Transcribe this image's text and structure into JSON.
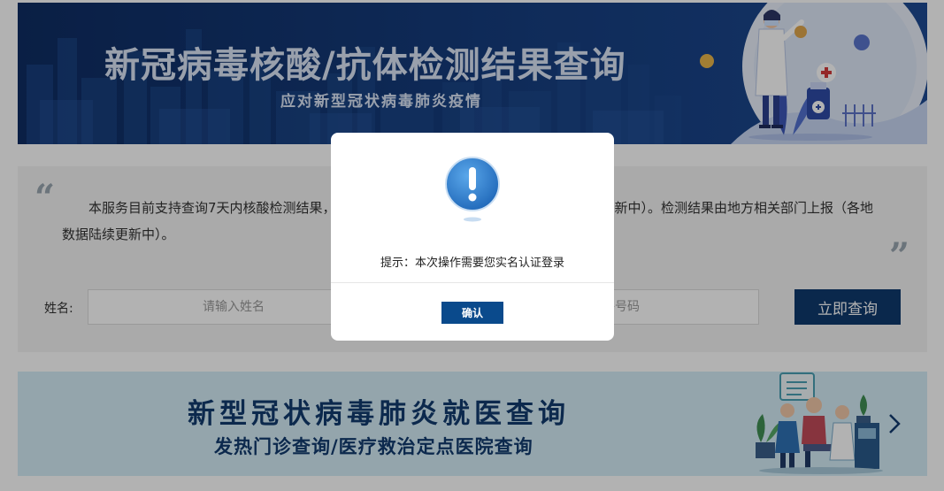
{
  "banner": {
    "title": "新冠病毒核酸/抗体检测结果查询",
    "subtitle": "应对新型冠状病毒肺炎疫情"
  },
  "notice": {
    "text": "本服务目前支持查询7天内核酸检测结果，检测结果由地方相关部门上报（各地数据陆续更新中）。检测结果由地方相关部门上报（各地数据陆续更新中）。"
  },
  "form": {
    "name_label": "姓名:",
    "name_placeholder": "请输入姓名",
    "id_placeholder": "请输入证件号码",
    "query_button": "立即查询"
  },
  "bottom_banner": {
    "title": "新型冠状病毒肺炎就医查询",
    "subtitle": "发热门诊查询/医疗救治定点医院查询"
  },
  "modal": {
    "message": "提示：本次操作需要您实名认证登录",
    "confirm_label": "确认"
  },
  "colors": {
    "primary": "#0f3a6e",
    "confirm": "#0a4a8c",
    "banner_bg": "#163e80",
    "bottom_banner_bg": "#d5ecf6"
  }
}
